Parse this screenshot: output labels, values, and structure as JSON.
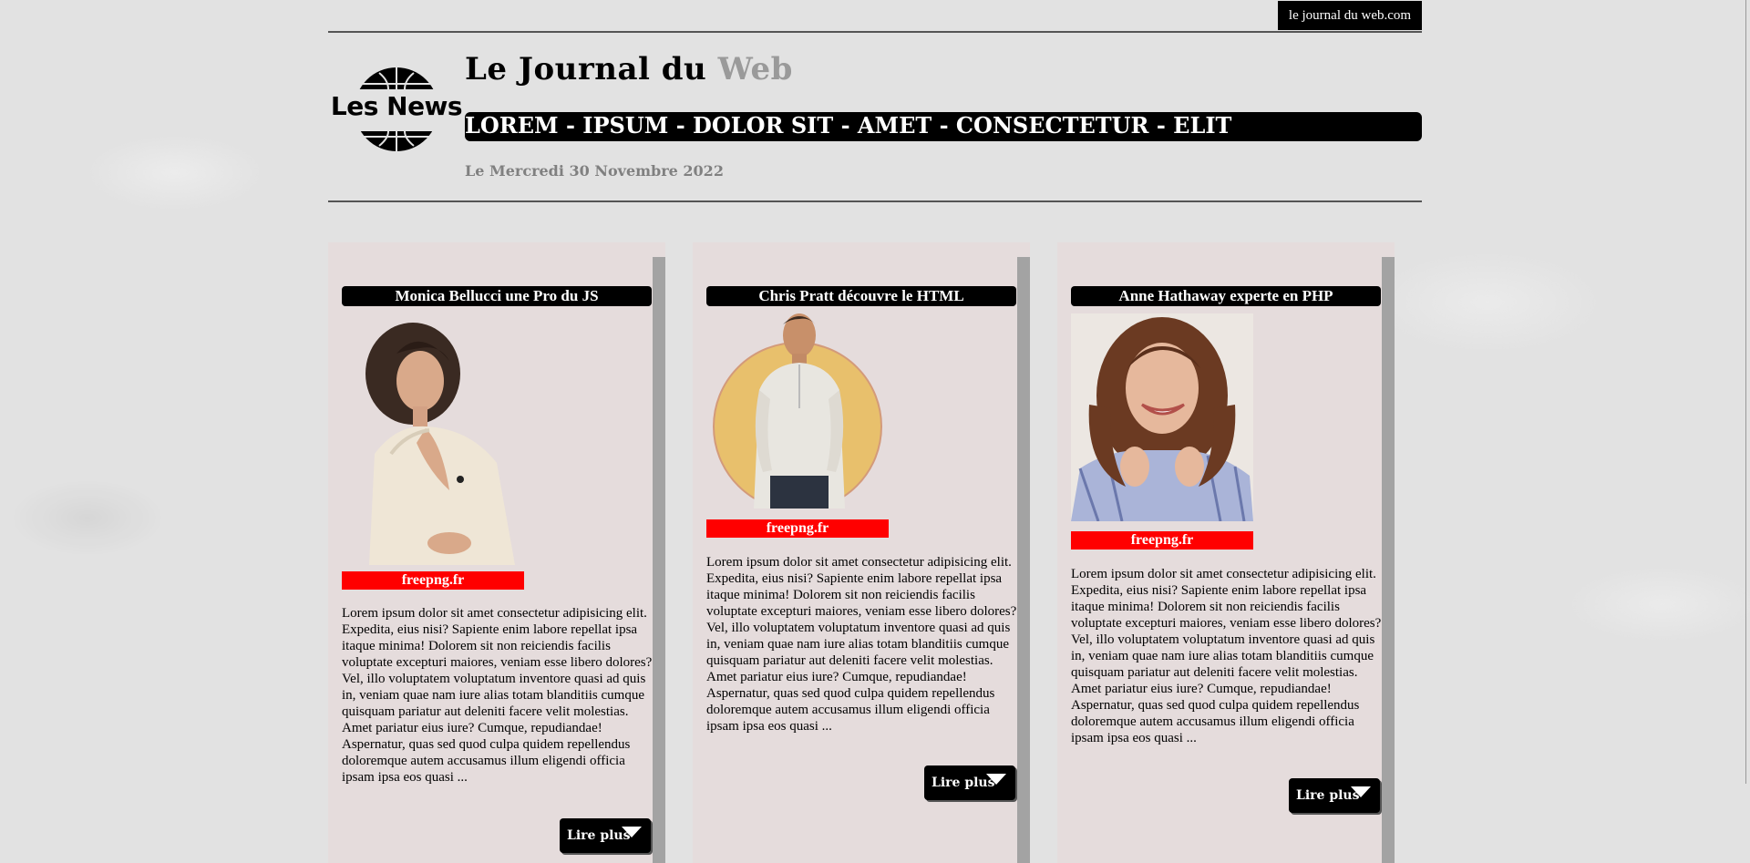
{
  "header": {
    "site_label": "le journal du web.com",
    "logo_text": "Les News",
    "title_main": "Le Journal du ",
    "title_accent": "Web",
    "nav": "LOREM - IPSUM - DOLOR SIT - AMET - CONSECTETUR - ELIT",
    "date": "Le Mercredi 30 Novembre 2022"
  },
  "articles": [
    {
      "title": "Monica Bellucci une Pro du JS",
      "credit": "freepng.fr",
      "body": "Lorem ipsum dolor sit amet consectetur adipisicing elit. Expedita, eius nisi? Sapiente enim labore repellat ipsa itaque minima! Dolorem sit non reiciendis facilis voluptate excepturi maiores, veniam esse libero dolores? Vel, illo voluptatem voluptatum inventore quasi ad quis in, veniam quae nam iure alias totam blanditiis cumque quisquam pariatur aut deleniti facere velit molestias. Amet pariatur eius iure? Cumque, repudiandae! Aspernatur, quas sed quod culpa quidem repellendus doloremque autem accusamus illum eligendi officia ipsam ipsa eos quasi ...",
      "button": "Lire plus"
    },
    {
      "title": "Chris Pratt découvre le HTML",
      "credit": "freepng.fr",
      "body": "Lorem ipsum dolor sit amet consectetur adipisicing elit. Expedita, eius nisi? Sapiente enim labore repellat ipsa itaque minima! Dolorem sit non reiciendis facilis voluptate excepturi maiores, veniam esse libero dolores? Vel, illo voluptatem voluptatum inventore quasi ad quis in, veniam quae nam iure alias totam blanditiis cumque quisquam pariatur aut deleniti facere velit molestias. Amet pariatur eius iure? Cumque, repudiandae! Aspernatur, quas sed quod culpa quidem repellendus doloremque autem accusamus illum eligendi officia ipsam ipsa eos quasi ...",
      "button": "Lire plus"
    },
    {
      "title": "Anne Hathaway experte en PHP",
      "credit": "freepng.fr",
      "body": "Lorem ipsum dolor sit amet consectetur adipisicing elit. Expedita, eius nisi? Sapiente enim labore repellat ipsa itaque minima! Dolorem sit non reiciendis facilis voluptate excepturi maiores, veniam esse libero dolores? Vel, illo voluptatem voluptatum inventore quasi ad quis in, veniam quae nam iure alias totam blanditiis cumque quisquam pariatur aut deleniti facere velit molestias. Amet pariatur eius iure? Cumque, repudiandae! Aspernatur, quas sed quod culpa quidem repellendus doloremque autem accusamus illum eligendi officia ipsam ipsa eos quasi ...",
      "button": "Lire plus"
    }
  ],
  "colors": {
    "card_bg": "#e5dcdc",
    "credit_bg": "#ff0000",
    "accent_gray": "#9a9a9a"
  },
  "icons": {
    "logo": "globe-icon",
    "read_more": "caret-down-icon"
  }
}
